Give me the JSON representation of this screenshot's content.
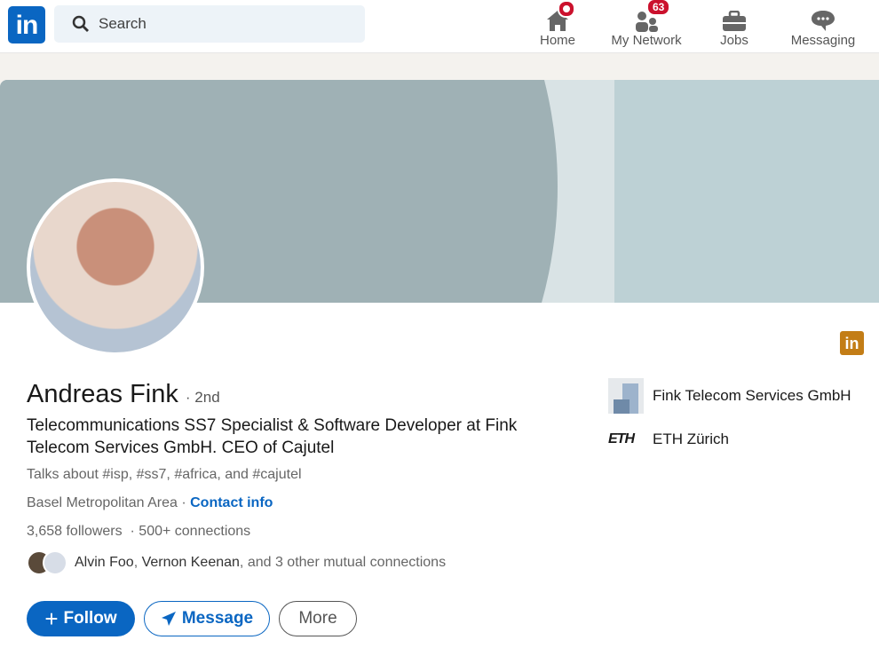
{
  "nav": {
    "search_placeholder": "Search",
    "items": [
      {
        "label": "Home",
        "icon": "home-icon",
        "badge": ""
      },
      {
        "label": "My Network",
        "icon": "network-icon",
        "badge": "63"
      },
      {
        "label": "Jobs",
        "icon": "briefcase-icon",
        "badge": ""
      },
      {
        "label": "Messaging",
        "icon": "messaging-icon",
        "badge": ""
      }
    ],
    "logo": "in"
  },
  "profile": {
    "name": "Andreas Fink",
    "degree": "· 2nd",
    "headline": "Telecommunications SS7 Specialist & Software Developer at Fink Telecom Services GmbH. CEO of Cajutel",
    "talks_about": "Talks about #isp, #ss7, #africa, and #cajutel",
    "location": "Basel Metropolitan Area ·",
    "contact_info": "Contact info",
    "followers": "3,658 followers",
    "connections": "· 500+ connections",
    "mutual_1": "Alvin Foo",
    "mutual_sep": ", ",
    "mutual_2": "Vernon Keenan",
    "mutual_rest": ", and 3 other mutual connections",
    "current_company": "Fink Telecom Services GmbH",
    "education": "ETH Zürich",
    "education_logo": "ETH"
  },
  "actions": {
    "follow": "Follow",
    "message": "Message",
    "more": "More"
  },
  "colors": {
    "accent": "#0a66c2",
    "badge": "#cb112d"
  }
}
